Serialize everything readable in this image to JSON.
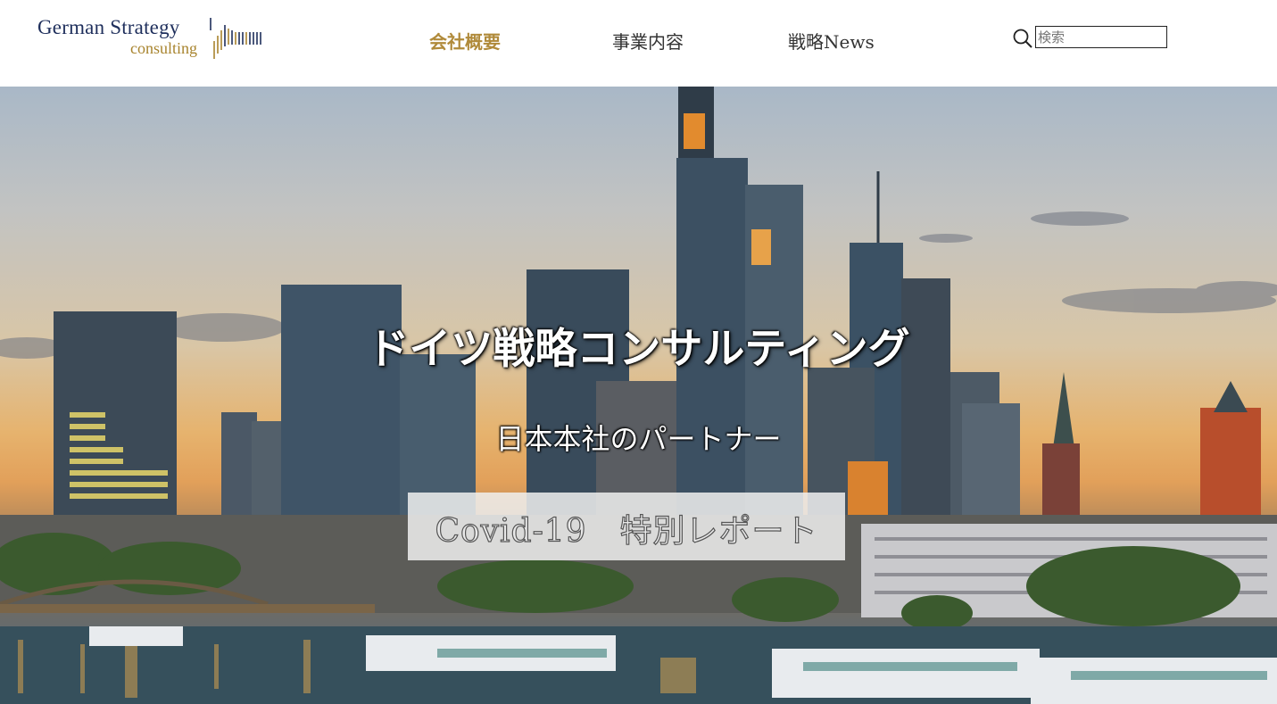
{
  "logo": {
    "main": "German Strategy",
    "sub": "consulting"
  },
  "nav": {
    "items": [
      "会社概要",
      "事業内容",
      "戦略News"
    ]
  },
  "search": {
    "placeholder": "検索",
    "value": ""
  },
  "hero": {
    "title": "ドイツ戦略コンサルティング",
    "subtitle": "日本本社のパートナー",
    "cta": "Covid-19　特別レポート"
  },
  "colors": {
    "brand_navy": "#1f2f5c",
    "brand_gold": "#a8842e",
    "nav_active": "#b08a3a"
  }
}
